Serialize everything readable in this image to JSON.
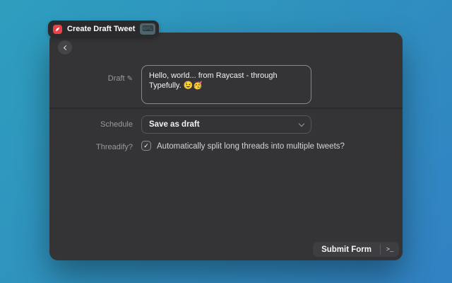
{
  "header_tab": {
    "title": "Create Draft Tweet",
    "app_icon": "typefully-icon",
    "shortcut_icon": "keyboard-icon"
  },
  "form": {
    "draft": {
      "label": "Draft",
      "value": "Hello, world... from Raycast - through Typefully. 😉🥳"
    },
    "schedule": {
      "label": "Schedule",
      "value": "Save as draft"
    },
    "threadify": {
      "label": "Threadify?",
      "checked": true,
      "description": "Automatically split long threads into multiple tweets?"
    }
  },
  "footer": {
    "submit_label": "Submit Form",
    "terminal_glyph": ">_"
  },
  "glyphs": {
    "pencil": "✎",
    "keyboard": "⌨",
    "check": "✓"
  },
  "colors": {
    "background_top_left": "#2E9EBE",
    "background_bottom_right": "#3181C3",
    "panel": "#343437",
    "accent_red": "#E8434A",
    "label_gray": "#9A9A9E"
  }
}
